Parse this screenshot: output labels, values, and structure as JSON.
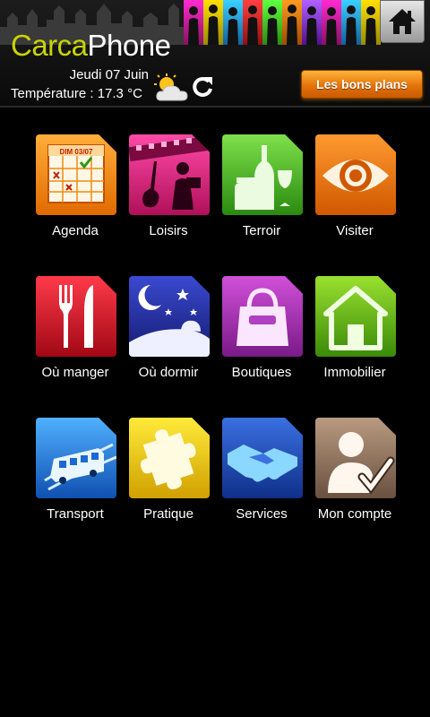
{
  "header": {
    "logo_part1": "Carca",
    "logo_part2": "Phone",
    "date": "Jeudi 07 Juin",
    "temperature": "Température : 17.3 °C",
    "deals_button": "Les bons plans",
    "weather_icon": "partly-cloudy-icon",
    "refresh_icon": "refresh-icon",
    "home_icon": "home-icon"
  },
  "colors": {
    "logo_accent": "#c8d400",
    "deals_button": "#f08a10"
  },
  "tiles": [
    {
      "label": "Agenda",
      "icon": "calendar-icon",
      "calendar_text": "DIM 03/07"
    },
    {
      "label": "Loisirs",
      "icon": "leisure-icon"
    },
    {
      "label": "Terroir",
      "icon": "wine-bottle-icon"
    },
    {
      "label": "Visiter",
      "icon": "eye-icon"
    },
    {
      "label": "Où manger",
      "icon": "fork-knife-icon"
    },
    {
      "label": "Où dormir",
      "icon": "night-sleep-icon"
    },
    {
      "label": "Boutiques",
      "icon": "shopping-bag-icon"
    },
    {
      "label": "Immobilier",
      "icon": "house-icon"
    },
    {
      "label": "Transport",
      "icon": "bus-icon"
    },
    {
      "label": "Pratique",
      "icon": "puzzle-icon"
    },
    {
      "label": "Services",
      "icon": "handshake-icon"
    },
    {
      "label": "Mon compte",
      "icon": "user-account-icon"
    }
  ]
}
